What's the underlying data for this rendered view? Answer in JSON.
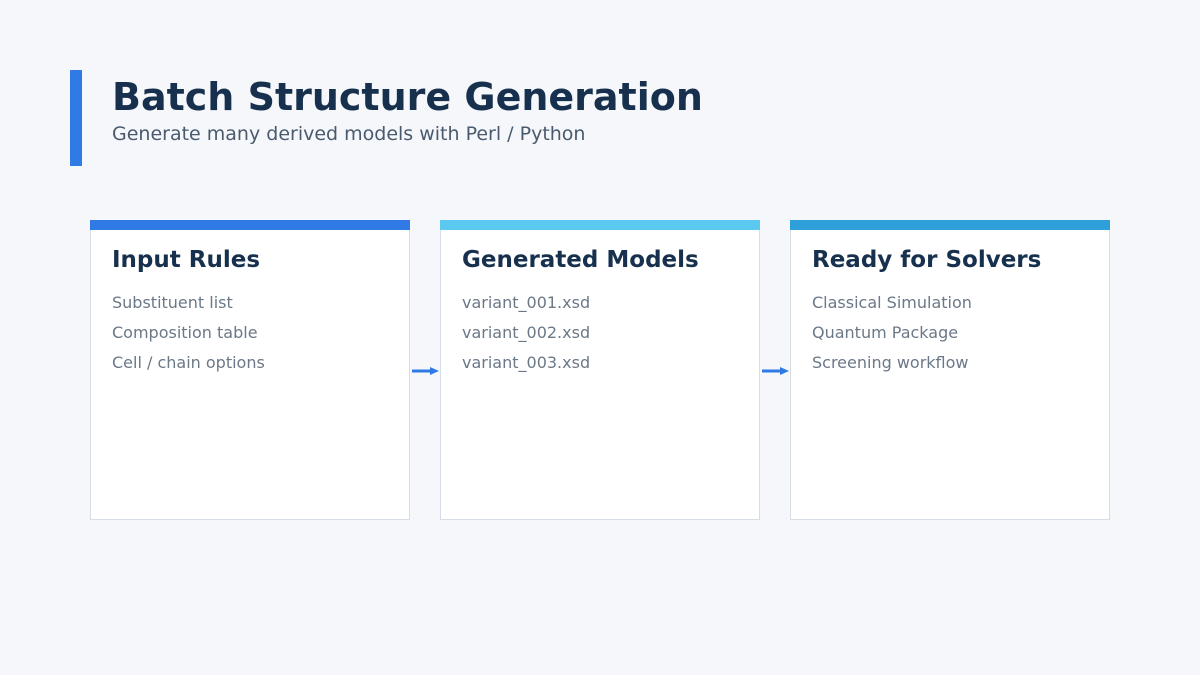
{
  "header": {
    "title": "Batch Structure Generation",
    "subtitle": "Generate many derived models with Perl / Python"
  },
  "colors": {
    "accent": "#2f7ae5",
    "card1_bar": "#2f7ae5",
    "card2_bar": "#5ac8ef",
    "card3_bar": "#2e9fd8",
    "arrow": "#2f7ae5"
  },
  "cards": [
    {
      "title": "Input Rules",
      "items": [
        "Substituent list",
        "Composition table",
        "Cell / chain options"
      ]
    },
    {
      "title": "Generated Models",
      "items": [
        "variant_001.xsd",
        "variant_002.xsd",
        "variant_003.xsd"
      ]
    },
    {
      "title": "Ready for Solvers",
      "items": [
        "Classical Simulation",
        "Quantum Package",
        "Screening workflow"
      ]
    }
  ]
}
